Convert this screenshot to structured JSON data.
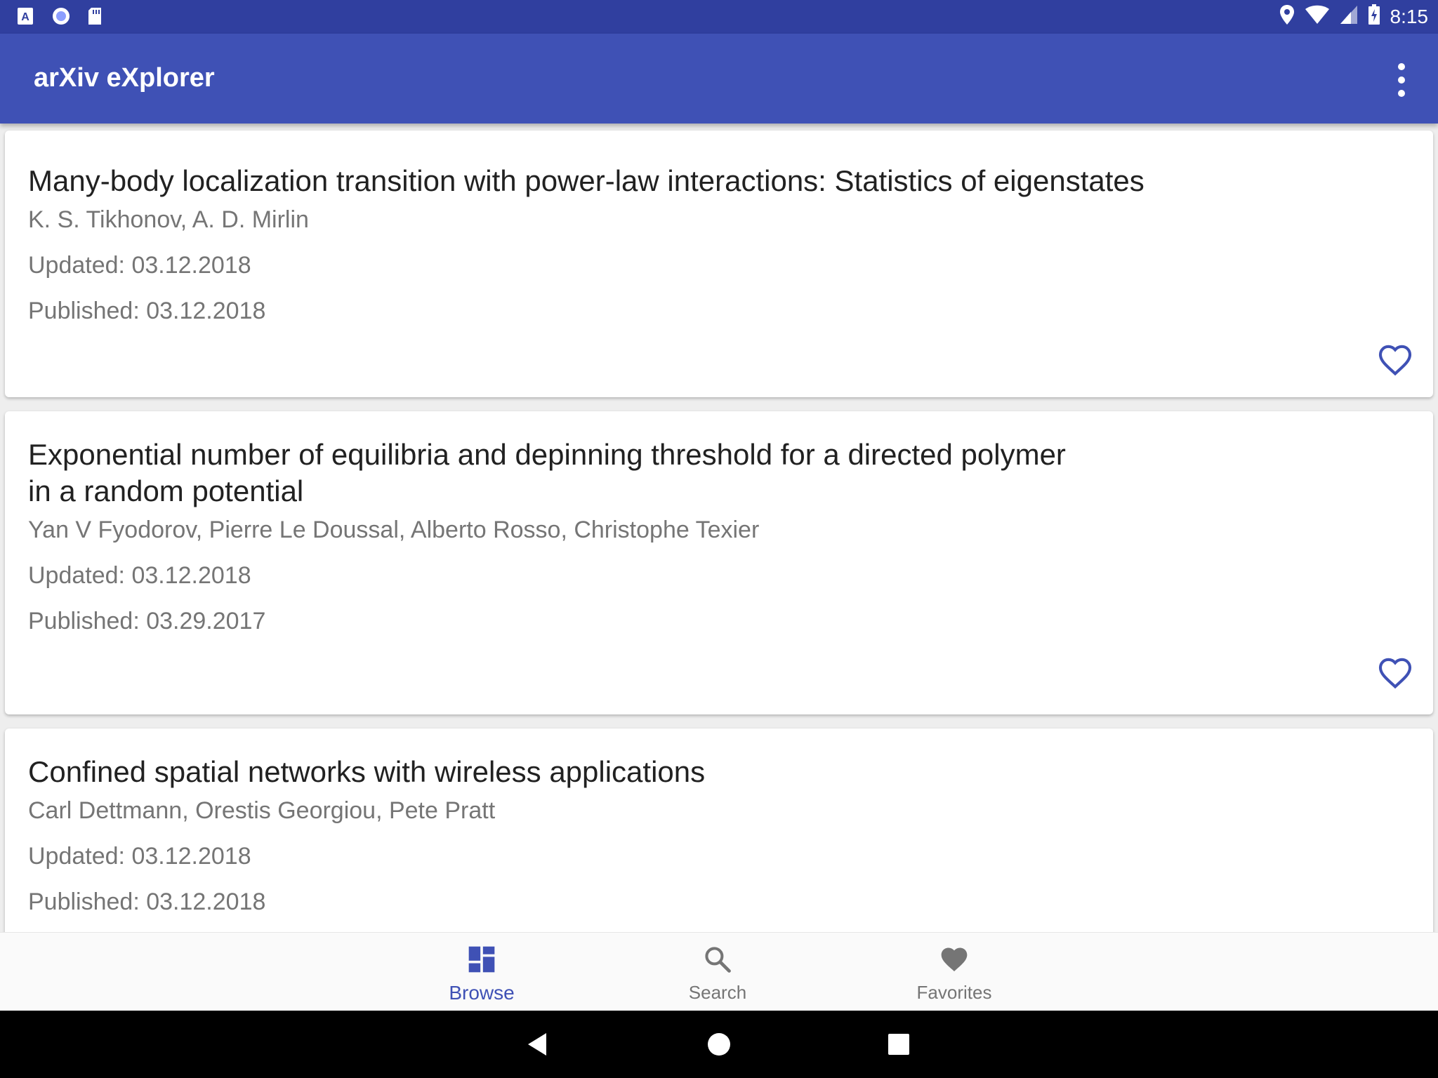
{
  "status_bar": {
    "time": "8:15",
    "left_icons": [
      "a-notification-icon",
      "circle-app-icon",
      "sd-card-icon"
    ],
    "right_icons": [
      "location-icon",
      "wifi-icon",
      "signal-icon",
      "battery-icon"
    ]
  },
  "app_bar": {
    "title": "arXiv eXplorer",
    "background_color": "#3f51b5",
    "status_bar_color": "#303f9f"
  },
  "papers": [
    {
      "title": "Many-body localization transition with power-law interactions: Statistics of eigenstates",
      "authors": "K. S. Tikhonov, A. D. Mirlin",
      "updated": "Updated: 03.12.2018",
      "published": "Published: 03.12.2018",
      "favorite_icon": "heart-outline-icon"
    },
    {
      "title_line1": "Exponential number of equilibria and depinning threshold for a directed polymer",
      "title_line2": "in a random potential",
      "authors": "Yan V Fyodorov, Pierre Le Doussal, Alberto Rosso, Christophe Texier",
      "updated": "Updated: 03.12.2018",
      "published": "Published: 03.29.2017",
      "favorite_icon": "heart-outline-icon"
    },
    {
      "title": "Confined spatial networks with wireless applications",
      "authors": "Carl Dettmann, Orestis Georgiou, Pete Pratt",
      "updated": "Updated: 03.12.2018",
      "published": "Published: 03.12.2018"
    }
  ],
  "bottom_nav": {
    "items": [
      {
        "label": "Browse",
        "icon": "dashboard-icon",
        "active": true
      },
      {
        "label": "Search",
        "icon": "search-icon",
        "active": false
      },
      {
        "label": "Favorites",
        "icon": "heart-filled-icon",
        "active": false
      }
    ],
    "active_color": "#3f51b5",
    "inactive_color": "#757575"
  },
  "system_nav": {
    "buttons": [
      "back-icon",
      "home-icon",
      "recents-icon"
    ]
  }
}
